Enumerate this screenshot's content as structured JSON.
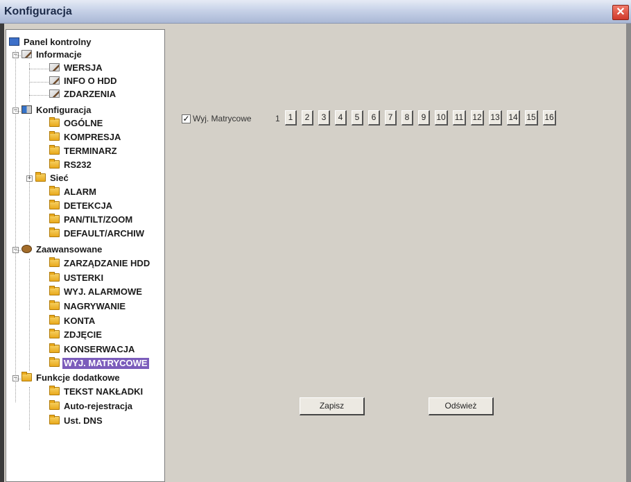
{
  "window": {
    "title": "Konfiguracja",
    "close_symbol": "✕"
  },
  "tree": {
    "root": "Panel kontrolny",
    "informacje": {
      "label": "Informacje",
      "items": [
        "WERSJA",
        "INFO O HDD",
        "ZDARZENIA"
      ]
    },
    "konfiguracja": {
      "label": "Konfiguracja",
      "items": [
        "OGÓLNE",
        "KOMPRESJA",
        "TERMINARZ",
        "RS232",
        "Sieć",
        "ALARM",
        "DETEKCJA",
        "PAN/TILT/ZOOM",
        "DEFAULT/ARCHIW"
      ]
    },
    "zaawansowane": {
      "label": "Zaawansowane",
      "items": [
        "ZARZĄDZANIE HDD",
        "USTERKI",
        "WYJ. ALARMOWE",
        "NAGRYWANIE",
        "KONTA",
        "ZDJĘCIE",
        "KONSERWACJA",
        "WYJ. MATRYCOWE"
      ]
    },
    "funkcje": {
      "label": "Funkcje dodatkowe",
      "items": [
        "TEKST NAKŁADKI",
        "Auto-rejestracja",
        "Ust. DNS"
      ]
    },
    "selected": "WYJ. MATRYCOWE"
  },
  "matrix": {
    "checkbox_checked": true,
    "check_symbol": "✓",
    "label": "Wyj. Matrycowe",
    "first_channel": "1",
    "buttons": [
      "1",
      "2",
      "3",
      "4",
      "5",
      "6",
      "7",
      "8",
      "9",
      "10",
      "11",
      "12",
      "13",
      "14",
      "15",
      "16"
    ]
  },
  "actions": {
    "save": "Zapisz",
    "refresh": "Odśwież"
  },
  "colors": {
    "selected_bg": "#7b5cbb",
    "panel_bg": "#d4d0c8",
    "folder": "#e9a91c"
  }
}
